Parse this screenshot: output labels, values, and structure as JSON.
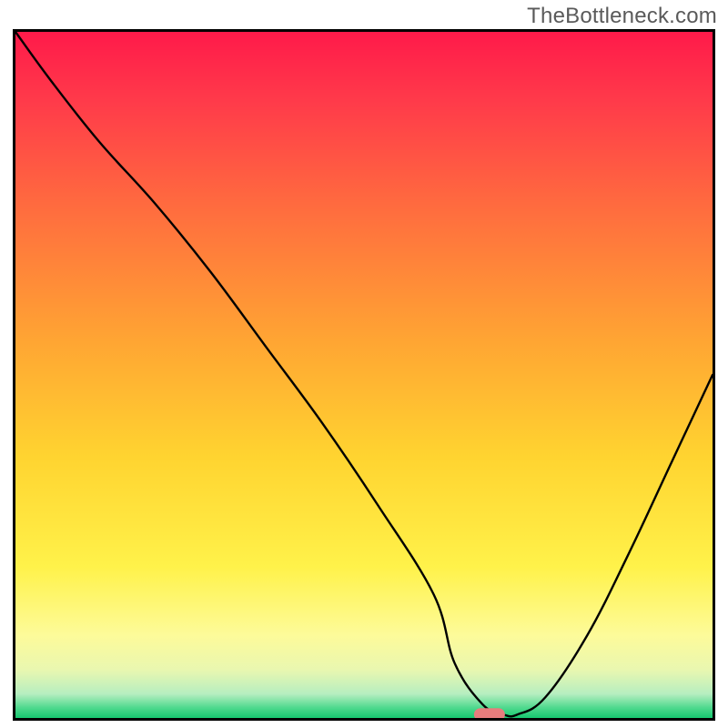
{
  "watermark": "TheBottleneck.com",
  "chart_data": {
    "type": "line",
    "title": "",
    "xlabel": "",
    "ylabel": "",
    "xlim": [
      0,
      100
    ],
    "ylim": [
      0,
      100
    ],
    "grid": false,
    "axes_visible": {
      "ticks": false,
      "labels": false,
      "box": true
    },
    "series": [
      {
        "name": "bottleneck-curve",
        "x": [
          0,
          5,
          12,
          20,
          28,
          36,
          44,
          52,
          60,
          63,
          67,
          70,
          72,
          76,
          82,
          88,
          94,
          100
        ],
        "y": [
          100,
          93,
          84,
          75,
          65,
          54,
          43,
          31,
          18,
          8,
          2,
          0.5,
          0.5,
          3,
          12,
          24,
          37,
          50
        ]
      }
    ],
    "marker": {
      "name": "current-config",
      "x": 68,
      "y": 0.5,
      "shape": "capsule",
      "color": "#e77d7d"
    },
    "background_gradient": {
      "type": "vertical",
      "stops": [
        {
          "pos": 0.0,
          "color": "#ff1a4a"
        },
        {
          "pos": 0.1,
          "color": "#ff3a4a"
        },
        {
          "pos": 0.25,
          "color": "#ff6a3f"
        },
        {
          "pos": 0.45,
          "color": "#ffa533"
        },
        {
          "pos": 0.62,
          "color": "#ffd430"
        },
        {
          "pos": 0.78,
          "color": "#fff24a"
        },
        {
          "pos": 0.88,
          "color": "#fdfb9a"
        },
        {
          "pos": 0.93,
          "color": "#e9f7b0"
        },
        {
          "pos": 0.965,
          "color": "#b6eec0"
        },
        {
          "pos": 0.985,
          "color": "#4fd98e"
        },
        {
          "pos": 1.0,
          "color": "#17c76f"
        }
      ]
    }
  }
}
